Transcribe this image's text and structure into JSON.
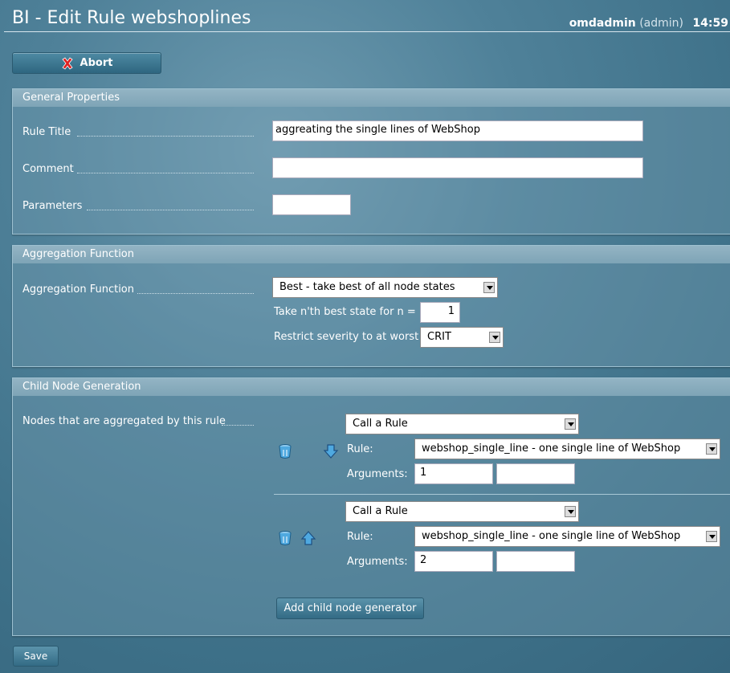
{
  "header": {
    "title": "BI - Edit Rule webshoplines",
    "user": "omdadmin",
    "role": "(admin)",
    "time": "14:59"
  },
  "toolbar": {
    "abort_label": "Abort"
  },
  "general": {
    "heading": "General Properties",
    "rule_title_label": "Rule Title",
    "rule_title_value": "aggreating the single lines of WebShop",
    "comment_label": "Comment",
    "comment_value": "",
    "parameters_label": "Parameters",
    "parameters_value": ""
  },
  "aggregation": {
    "heading": "Aggregation Function",
    "label": "Aggregation Function",
    "selected": "Best - take best of all node states",
    "nth_label": "Take n'th best state for n =",
    "nth_value": "1",
    "restrict_label": "Restrict severity to at worst",
    "restrict_value": "CRIT"
  },
  "children": {
    "heading": "Child Node Generation",
    "label": "Nodes that are aggregated by this rule",
    "nodes": [
      {
        "type": "Call a Rule",
        "rule_label": "Rule:",
        "rule": "webshop_single_line - one single line of WebShop",
        "args_label": "Arguments:",
        "arg1": "1",
        "arg2": ""
      },
      {
        "type": "Call a Rule",
        "rule_label": "Rule:",
        "rule": "webshop_single_line - one single line of WebShop",
        "args_label": "Arguments:",
        "arg1": "2",
        "arg2": ""
      }
    ],
    "add_label": "Add child node generator"
  },
  "footer": {
    "save_label": "Save"
  },
  "colors": {
    "background": "#3e7189",
    "header": "#7ea4b6",
    "button": "#336b85"
  }
}
